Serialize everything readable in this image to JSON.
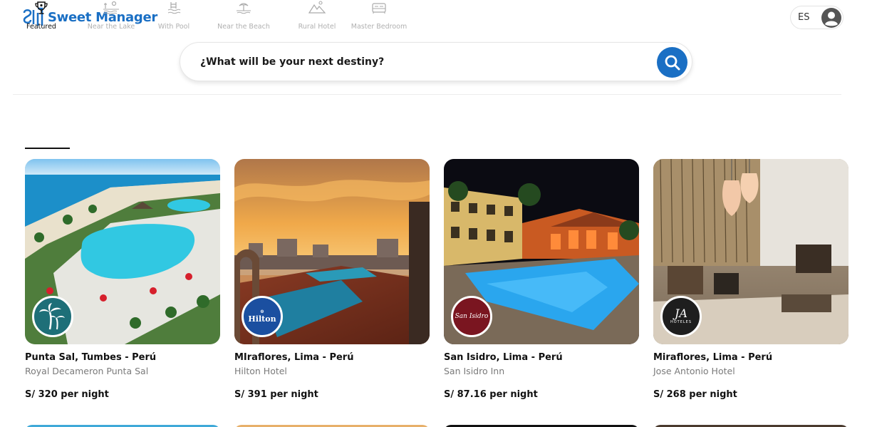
{
  "app": {
    "name": "Sweet Manager",
    "brand_color": "#1a6fc4"
  },
  "header": {
    "language": "ES",
    "logo_icon": "sweet-manager-logo-icon",
    "avatar_icon": "user-avatar-icon"
  },
  "search": {
    "placeholder": "¿What will be your next destiny?",
    "button_icon": "search-icon"
  },
  "categories": [
    {
      "label": "Featured",
      "icon": "trophy-icon",
      "active": true
    },
    {
      "label": "Near the Lake",
      "icon": "lake-icon",
      "active": false
    },
    {
      "label": "With Pool",
      "icon": "pool-icon",
      "active": false
    },
    {
      "label": "Near the Beach",
      "icon": "beach-icon",
      "active": false
    },
    {
      "label": "Rural Hotel",
      "icon": "mountain-icon",
      "active": false
    },
    {
      "label": "Master Bedroom",
      "icon": "bed-icon",
      "active": false
    }
  ],
  "listings": [
    {
      "location": "Punta Sal, Tumbes - Perú",
      "hotel": "Royal Decameron Punta Sal",
      "price": "S/ 320 per night"
    },
    {
      "location": "MIraflores, Lima - Perú",
      "hotel": "Hilton Hotel",
      "price": "S/ 391 per night",
      "badge_text": "Hilton"
    },
    {
      "location": "San Isidro, Lima - Perú",
      "hotel": "San Isidro Inn",
      "price": "S/ 87.16 per night",
      "badge_text": "San Isidro"
    },
    {
      "location": "Miraflores, Lima - Perú",
      "hotel": "Jose Antonio Hotel",
      "price": "S/ 268 per night",
      "badge_text": "HOTELES"
    }
  ]
}
